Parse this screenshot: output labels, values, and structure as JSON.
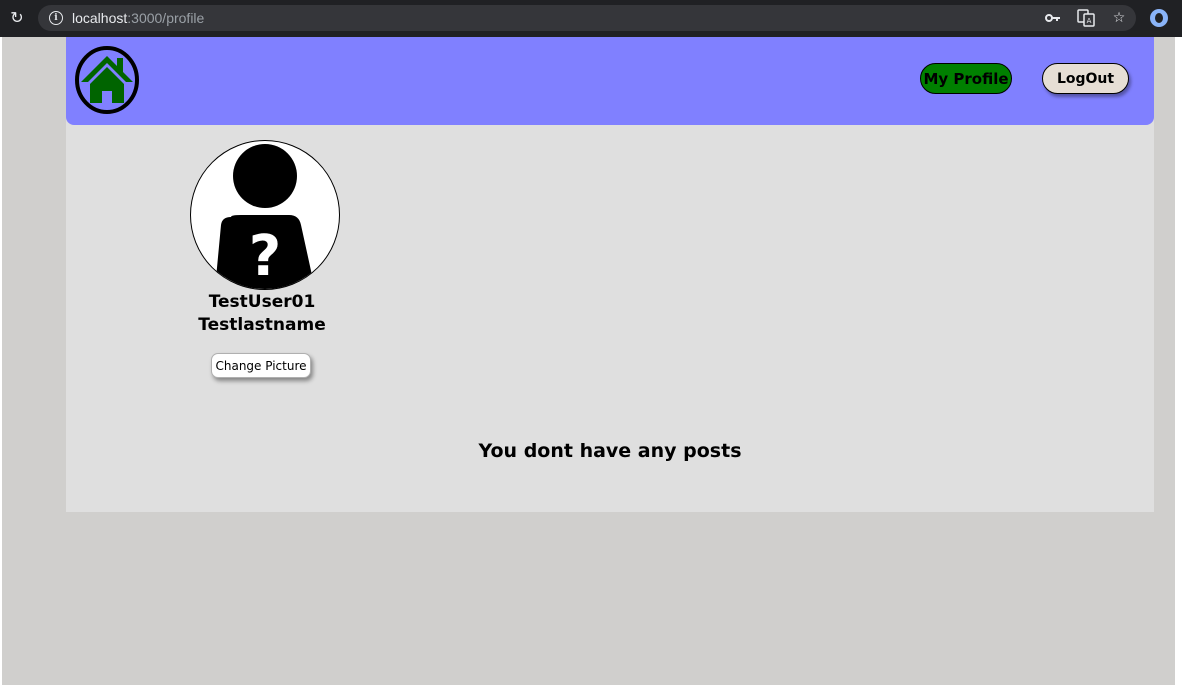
{
  "browser": {
    "url_host": "localhost",
    "url_path": ":3000/profile",
    "icons": [
      "reload-icon",
      "site-info-icon",
      "key-icon",
      "translate-icon",
      "bookmark-star-icon",
      "extension-icon"
    ]
  },
  "navbar": {
    "logo_icon": "home-icon",
    "profile_label": "My Profile",
    "logout_label": "LogOut"
  },
  "profile": {
    "avatar_icon": "unknown-user-icon",
    "first_name": "TestUser01",
    "last_name": "Testlastname",
    "change_picture_label": "Change Picture"
  },
  "posts": {
    "empty_message": "You dont have any posts"
  },
  "colors": {
    "navbar": "#8080ff",
    "content": "#dfdfdf",
    "page_background": "#d0cfcd",
    "profile_button": "#008000",
    "logout_button": "#e6ded5",
    "home_icon": "#006400"
  }
}
